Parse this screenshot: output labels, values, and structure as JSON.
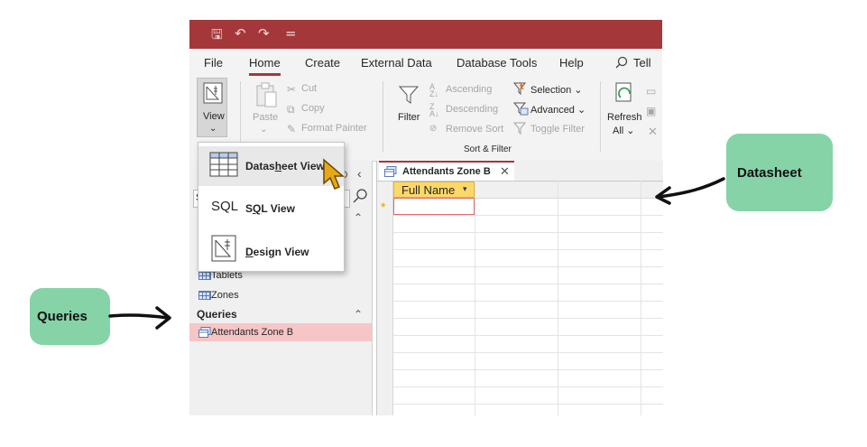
{
  "quick_access": {
    "save": "🖫",
    "undo": "↶",
    "redo": "↷",
    "customize": "="
  },
  "menu": [
    "File",
    "Home",
    "Create",
    "External Data",
    "Database Tools",
    "Help",
    "Tell"
  ],
  "ribbon": {
    "view_label": "View",
    "paste_label": "Paste",
    "cut": "Cut",
    "copy": "Copy",
    "format_painter": "Format Painter",
    "filter_label": "Filter",
    "ascending": "Ascending",
    "descending": "Descending",
    "remove_sort": "Remove Sort",
    "selection": "Selection ⌄",
    "advanced": "Advanced ⌄",
    "toggle_filter": "Toggle Filter",
    "sort_filter_group": "Sort & Filter",
    "refresh_label": "Refresh",
    "refresh_all": "All ⌄"
  },
  "view_dropdown": {
    "items": [
      {
        "icon": "datasheet-icon",
        "label": "Datasheet View",
        "hotkey_char": "h"
      },
      {
        "icon": "sql-icon",
        "icon_text": "SQL",
        "label": "SQL View",
        "hotkey_char": "Q"
      },
      {
        "icon": "design-icon",
        "label": "Design View",
        "hotkey_char": "D"
      }
    ]
  },
  "nav_pane": {
    "items": [
      "Tablets",
      "Zones"
    ],
    "queries_header": "Queries",
    "queries": [
      "Attendants Zone B"
    ],
    "search_partial": "S"
  },
  "document": {
    "tab_title": "Attendants Zone B",
    "column": "Full Name",
    "new_row_marker": "*"
  },
  "annotations": {
    "datasheet": "Datasheet",
    "queries": "Queries"
  },
  "colors": {
    "access_red": "#a4373a",
    "column_header": "#fcd86a",
    "selected_query": "#f7c5c6",
    "callout_green": "#86d3a8",
    "cursor": "#e6a817"
  }
}
